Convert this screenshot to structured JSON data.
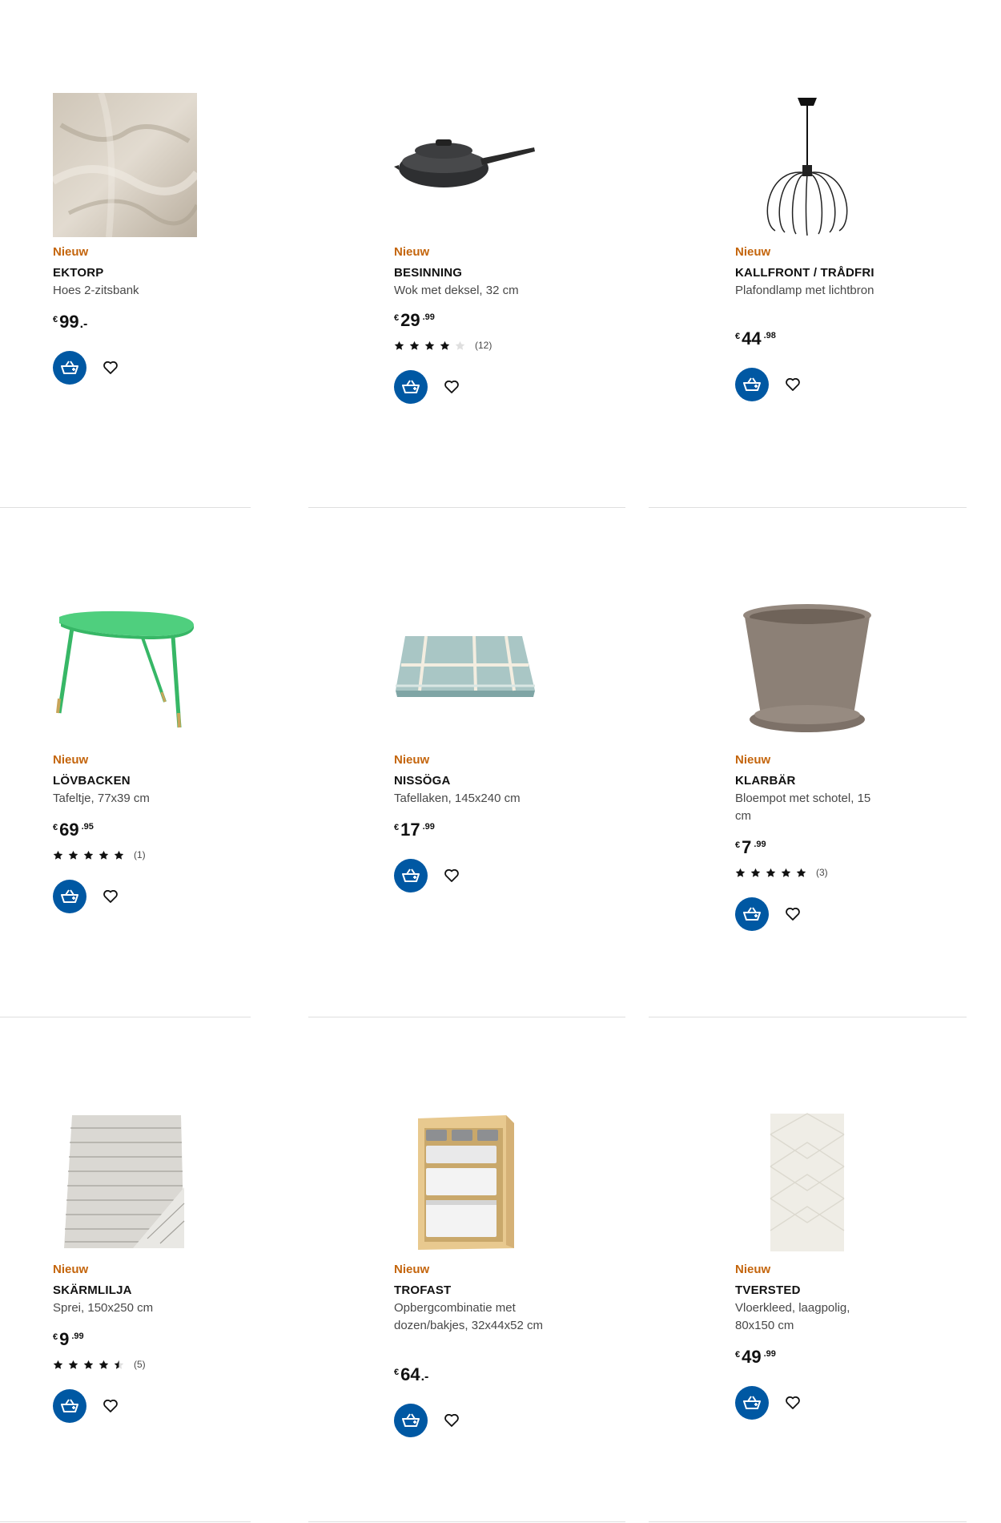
{
  "products": [
    {
      "badge": "Nieuw",
      "name": "EKTORP",
      "desc": "Hoes 2-zitsbank",
      "currency": "€",
      "price_int": "99",
      "price_dec": "",
      "price_dash": ".-",
      "rating_count": "",
      "stars": 0,
      "image": "fabric-swatch"
    },
    {
      "badge": "Nieuw",
      "name": "BESINNING",
      "desc": "Wok met deksel, 32 cm",
      "currency": "€",
      "price_int": "29",
      "price_dec": ".99",
      "price_dash": "",
      "rating_count": "(12)",
      "stars": 4,
      "image": "wok-with-lid"
    },
    {
      "badge": "Nieuw",
      "name": "KALLFRONT / TRÅDFRI",
      "desc": "Plafondlamp met lichtbron",
      "currency": "€",
      "price_int": "44",
      "price_dec": ".98",
      "price_dash": "",
      "rating_count": "",
      "stars": 0,
      "image": "wire-pendant-lamp"
    },
    {
      "badge": "Nieuw",
      "name": "LÖVBACKEN",
      "desc": "Tafeltje, 77x39 cm",
      "currency": "€",
      "price_int": "69",
      "price_dec": ".95",
      "price_dash": "",
      "rating_count": "(1)",
      "stars": 5,
      "image": "green-side-table"
    },
    {
      "badge": "Nieuw",
      "name": "NISSÖGA",
      "desc": "Tafellaken, 145x240 cm",
      "currency": "€",
      "price_int": "17",
      "price_dec": ".99",
      "price_dash": "",
      "rating_count": "",
      "stars": 0,
      "image": "checked-tablecloth"
    },
    {
      "badge": "Nieuw",
      "name": "KLARBÄR",
      "desc": "Bloempot met schotel, 15 cm",
      "currency": "€",
      "price_int": "7",
      "price_dec": ".99",
      "price_dash": "",
      "rating_count": "(3)",
      "stars": 5,
      "image": "flower-pot"
    },
    {
      "badge": "Nieuw",
      "name": "SKÄRMLILJA",
      "desc": "Sprei, 150x250 cm",
      "currency": "€",
      "price_int": "9",
      "price_dec": ".99",
      "price_dash": "",
      "rating_count": "(5)",
      "stars": 4.5,
      "image": "striped-bedspread"
    },
    {
      "badge": "Nieuw",
      "name": "TROFAST",
      "desc": "Opbergcombinatie met dozen/bakjes, 32x44x52 cm",
      "currency": "€",
      "price_int": "64",
      "price_dec": "",
      "price_dash": ".-",
      "rating_count": "",
      "stars": 0,
      "image": "storage-box-unit"
    },
    {
      "badge": "Nieuw",
      "name": "TVERSTED",
      "desc": "Vloerkleed, laagpolig, 80x150 cm",
      "currency": "€",
      "price_int": "49",
      "price_dec": ".99",
      "price_dash": "",
      "rating_count": "",
      "stars": 0,
      "image": "cream-rug"
    }
  ],
  "colors": {
    "badge": "#c4650c",
    "cart_button": "#0058a3",
    "divider": "#dfdfdf",
    "star": "#111111",
    "star_empty": "#dfdfdf"
  },
  "icons": {
    "cart": "add-to-cart-icon",
    "favourite": "heart-icon",
    "star": "star-icon"
  }
}
